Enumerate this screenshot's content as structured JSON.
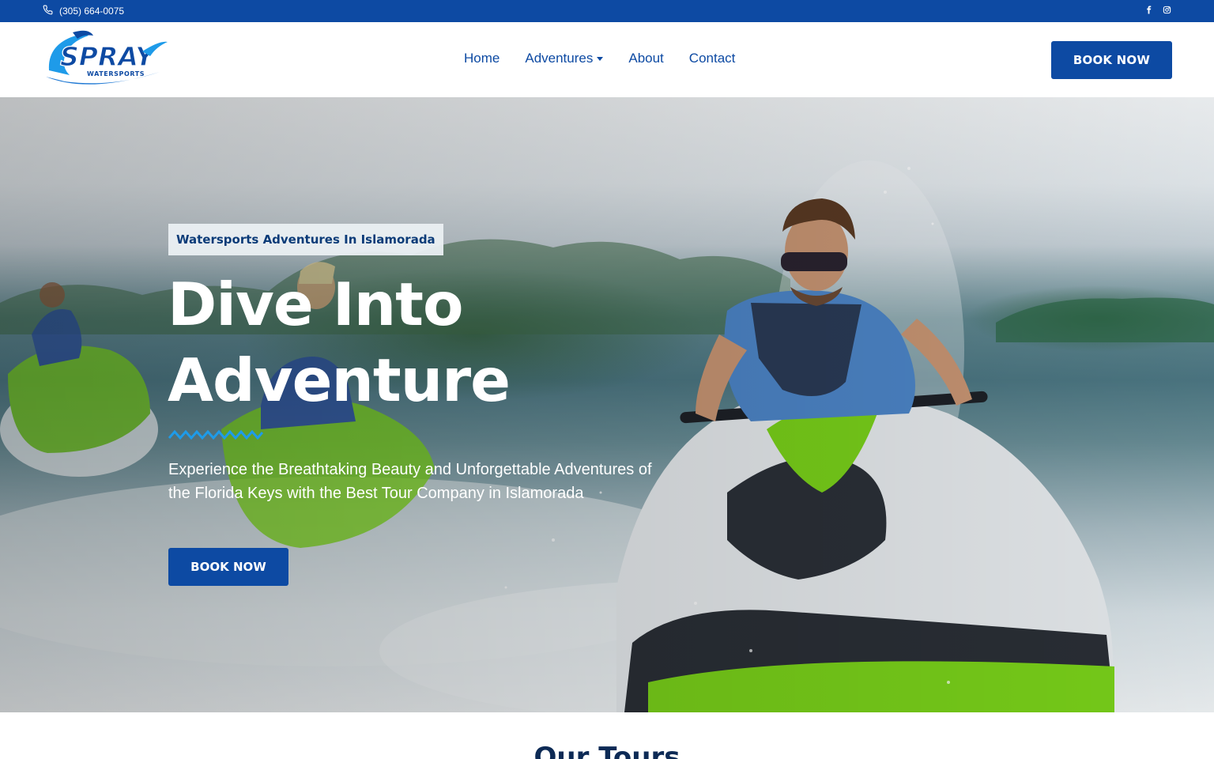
{
  "topbar": {
    "phone": "(305) 664-0075",
    "phone_icon": "phone-icon",
    "social": [
      "facebook-icon",
      "instagram-icon"
    ]
  },
  "header": {
    "logo": {
      "name": "SPRAY",
      "tagline": "WATERSPORTS"
    },
    "nav": [
      {
        "label": "Home",
        "has_dropdown": false
      },
      {
        "label": "Adventures",
        "has_dropdown": true
      },
      {
        "label": "About",
        "has_dropdown": false
      },
      {
        "label": "Contact",
        "has_dropdown": false
      }
    ],
    "book_label": "BOOK NOW"
  },
  "hero": {
    "tag": "Watersports Adventures In Islamorada",
    "title_line1": "Dive Into",
    "title_line2": "Adventure",
    "subtitle": "Experience the Breathtaking Beauty and Unforgettable Adventures of the Florida Keys with the Best Tour Company in Islamorada",
    "button_label": "BOOK NOW"
  },
  "section": {
    "heading": "Our Tours"
  },
  "colors": {
    "brand_blue": "#0d4aa3",
    "accent_wave": "#1e9be9",
    "jetski_green": "#7ad21a"
  }
}
